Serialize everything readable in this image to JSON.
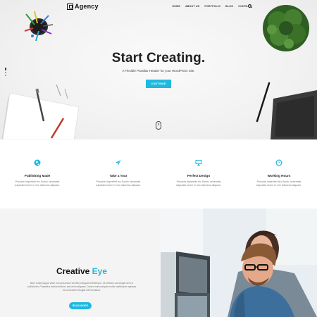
{
  "brand": {
    "name": "Agency"
  },
  "nav": {
    "items": [
      {
        "label": "HOME"
      },
      {
        "label": "ABOUT US"
      },
      {
        "label": "PORTFOLIO"
      },
      {
        "label": "BLOG"
      },
      {
        "label": "CONTACT"
      }
    ],
    "search_icon": "search-icon"
  },
  "hero": {
    "title": "Start Creating.",
    "subtitle": "A Flexible Parallax Header for your WordPress Site.",
    "button_label": "CONTINUE"
  },
  "features": [
    {
      "icon": "globe-icon",
      "title": "Publishing Made",
      "text": "Posuere imperdiet leo Donec venenatis vulputate lorem in nec laboreos aliquam."
    },
    {
      "icon": "airplane-icon",
      "title": "Take a Tour",
      "text": "Posuere imperdiet leo Donec venenatis vulputate lorem in nec laboreos aliquam."
    },
    {
      "icon": "monitor-icon",
      "title": "Perfect Design",
      "text": "Posuere imperdiet leo Donec venenatis vulputate lorem in nec laboreos aliquam."
    },
    {
      "icon": "clock-icon",
      "title": "Working Hours",
      "text": "Posuere imperdiet leo Donec venenatis vulputate lorem in nec laboreos aliquam."
    }
  ],
  "creative": {
    "title_main": "Creative",
    "title_accent": "Eye",
    "text": "Nam mollis augue vitae orci accumsan vel felis volutpat velit tempor. Ut ultricies consequat sem in sollicitudin. Phasellus tincidunt libero sed enim aliquam. Donec lorem aliquet mollis vestibulum egestas id consectetur feugiat nibh tincidunt.",
    "button_label": "READ MORE"
  },
  "colors": {
    "accent": "#1fb9df",
    "hero_bg": "#f1f1f1",
    "section_bg": "#f4f4f4"
  }
}
